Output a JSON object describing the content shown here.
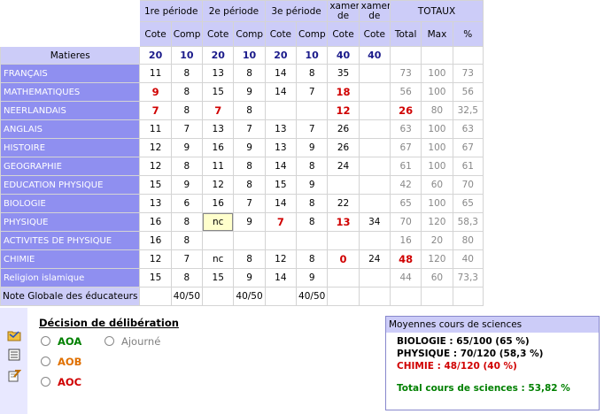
{
  "grid": {
    "groups": [
      "1re période",
      "2e période",
      "3e période",
      "xamer de",
      "xamer de",
      "TOTAUX"
    ],
    "subheaders": [
      "Cote",
      "Comp",
      "Cote",
      "Comp",
      "Cote",
      "Comp",
      "Cote",
      "Cote",
      "Total",
      "Max",
      "%"
    ],
    "matieres_label": "Matieres",
    "max_values": [
      "20",
      "10",
      "20",
      "10",
      "20",
      "10",
      "40",
      "40"
    ],
    "rows": [
      {
        "name": "FRANÇAIS",
        "cells": [
          "11",
          "8",
          "13",
          "8",
          "14",
          "8",
          "35",
          "",
          "73",
          "100",
          "73"
        ]
      },
      {
        "name": "MATHEMATIQUES",
        "cells": [
          "9",
          "8",
          "15",
          "9",
          "14",
          "7",
          "18",
          "",
          "56",
          "100",
          "56"
        ]
      },
      {
        "name": "NEERLANDAIS",
        "cells": [
          "7",
          "8",
          "7",
          "8",
          "",
          "",
          "12",
          "",
          "26",
          "80",
          "32,5"
        ]
      },
      {
        "name": "ANGLAIS",
        "cells": [
          "11",
          "7",
          "13",
          "7",
          "13",
          "7",
          "26",
          "",
          "63",
          "100",
          "63"
        ]
      },
      {
        "name": "HISTOIRE",
        "cells": [
          "12",
          "9",
          "16",
          "9",
          "13",
          "9",
          "26",
          "",
          "67",
          "100",
          "67"
        ]
      },
      {
        "name": "GEOGRAPHIE",
        "cells": [
          "12",
          "8",
          "11",
          "8",
          "14",
          "8",
          "24",
          "",
          "61",
          "100",
          "61"
        ]
      },
      {
        "name": "EDUCATION PHYSIQUE",
        "cells": [
          "15",
          "9",
          "12",
          "8",
          "15",
          "9",
          "",
          "",
          "42",
          "60",
          "70"
        ]
      },
      {
        "name": "BIOLOGIE",
        "cells": [
          "13",
          "6",
          "16",
          "7",
          "14",
          "8",
          "22",
          "",
          "65",
          "100",
          "65"
        ]
      },
      {
        "name": "PHYSIQUE",
        "cells": [
          "16",
          "8",
          "nc",
          "9",
          "7",
          "8",
          "13",
          "34",
          "70",
          "120",
          "58,3"
        ]
      },
      {
        "name": "ACTIVITES DE PHYSIQUE",
        "cells": [
          "16",
          "8",
          "",
          "",
          "",
          "",
          "",
          "",
          "16",
          "20",
          "80"
        ]
      },
      {
        "name": "CHIMIE",
        "cells": [
          "12",
          "7",
          "nc",
          "8",
          "12",
          "8",
          "0",
          "24",
          "48",
          "120",
          "40"
        ]
      },
      {
        "name": "Religion islamique",
        "cells": [
          "15",
          "8",
          "15",
          "9",
          "14",
          "9",
          "",
          "",
          "44",
          "60",
          "73,3"
        ]
      }
    ],
    "global_label": "Note Globale des éducateurs",
    "global_values": [
      "40/50",
      "40/50",
      "40/50"
    ]
  },
  "decision": {
    "title": "Décision de délibération",
    "options": [
      {
        "label": "AOA",
        "color": "#008000"
      },
      {
        "label": "Ajourné",
        "color": "#808080"
      },
      {
        "label": "AOB",
        "color": "#e07000"
      },
      {
        "label": "AOC",
        "color": "#d00000"
      }
    ]
  },
  "sciences": {
    "title": "Moyennes cours de sciences",
    "lines": [
      {
        "text": "BIOLOGIE : 65/100  (65 %)",
        "color": "#000000"
      },
      {
        "text": "PHYSIQUE : 70/120  (58,3 %)",
        "color": "#000000"
      },
      {
        "text": "CHIMIE : 48/120  (40 %)",
        "color": "#d00000"
      }
    ],
    "total": {
      "text": "Total cours de sciences : 53,82 %",
      "color": "#008000"
    }
  },
  "sidebar_icons": [
    "folder-icon",
    "list-icon",
    "document-edit-icon"
  ]
}
